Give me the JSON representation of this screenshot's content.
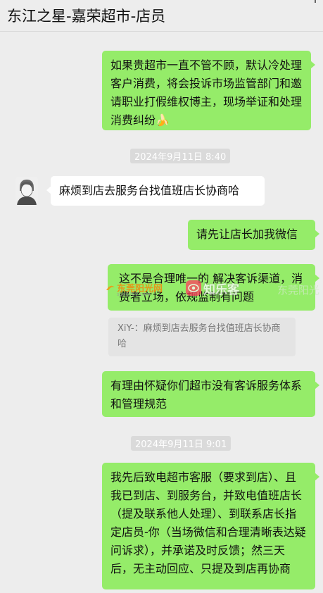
{
  "header": {
    "title": "东江之星-嘉荣超市-店员"
  },
  "messages": {
    "m1": "如果贵超市一直不管不顾，默认冷处理客户消费，将会投诉市场监管部门和邀请职业打假维权博主，现场举证和处理消费纠纷",
    "m1_emoji": "🍌",
    "time1": "2024年9月11日 8:40",
    "m2": "麻烦到店去服务台找值班店长协商哈",
    "m3": "请先让店长加我微信",
    "m4": "这不是合理唯一的 解决客诉渠道，消费者立场，依规监制有问题",
    "quote": "XiY-：麻烦到店去服务台找值班店长协商哈",
    "m5": "有理由怀疑你们超市没有客诉服务体系和管理规范",
    "time2": "2024年9月11日 9:01",
    "m6": "我先后致电超市客服（要求到店）、且我已到店、到服务台，并致电值班店长（提及联系他人处理）、到联系店长指定店员-你（当场微信和合理清晰表达疑问诉求），并承诺及时反馈；然三天后，无主动回应、只提及到店再协商"
  },
  "watermark": {
    "brand1": "东莞阳光网",
    "brand1_sub": "sun0769.com",
    "brand2": "知乐客",
    "brand3": "东莞阳光"
  },
  "colors": {
    "my_bubble": "#95ec69",
    "other_bubble": "#ffffff",
    "background": "#ededed"
  }
}
